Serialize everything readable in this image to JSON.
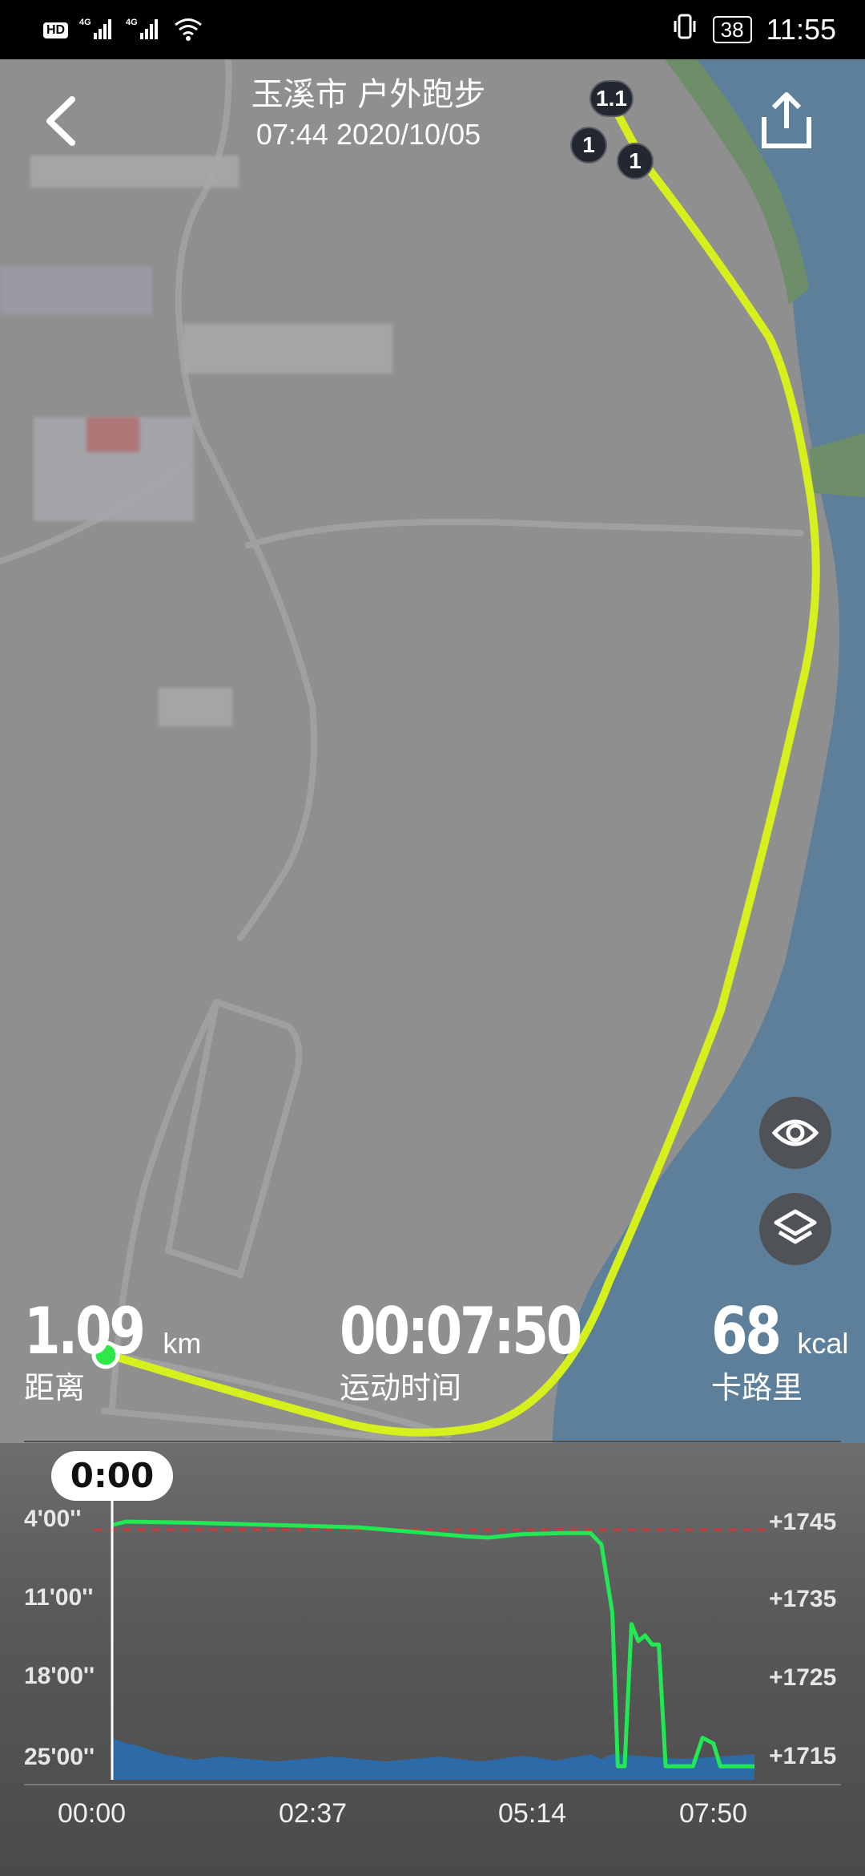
{
  "status_bar": {
    "network_left": "HD",
    "network_1": "4G",
    "network_2": "4G",
    "battery": "38",
    "time": "11:55"
  },
  "header": {
    "title": "玉溪市 户外跑步",
    "subtitle": "07:44 2020/10/05"
  },
  "map": {
    "km_markers": [
      "1",
      "1.1",
      "1"
    ],
    "route_color": "#d6f01e",
    "start_marker_color": "#2ee84a"
  },
  "stats": {
    "distance": {
      "value": "1.09",
      "unit": "km",
      "label": "距离"
    },
    "duration": {
      "value": "00:07:50",
      "label": "运动时间"
    },
    "calories": {
      "value": "68",
      "unit": "kcal",
      "label": "卡路里"
    }
  },
  "chart": {
    "current_time": "0:00",
    "pace_ticks": [
      "4'00''",
      "11'00''",
      "18'00''",
      "25'00''"
    ],
    "altitude_ticks": [
      "+1745",
      "+1735",
      "+1725",
      "+1715"
    ],
    "x_ticks": [
      "00:00",
      "02:37",
      "05:14",
      "07:50"
    ]
  },
  "chart_data": {
    "type": "line",
    "x_unit": "elapsed time (mm:ss)",
    "pace_axis": {
      "label_ticks": [
        "4'00''",
        "11'00''",
        "18'00''",
        "25'00''"
      ],
      "inverted": true
    },
    "altitude_axis": {
      "label_ticks": [
        1745,
        1735,
        1725,
        1715
      ]
    },
    "series": [
      {
        "kind": "line",
        "color": "#22e854",
        "points_time_s": [
          0,
          10,
          60,
          120,
          180,
          230,
          260,
          275,
          300,
          330,
          350,
          358,
          366,
          370,
          375,
          380,
          385,
          390,
          395,
          400,
          405,
          420,
          425,
          432,
          440,
          445,
          450,
          470
        ],
        "pace_min": [
          4.3,
          4.0,
          4.1,
          4.3,
          4.5,
          5.0,
          5.3,
          5.4,
          5.1,
          5.0,
          5.0,
          6.0,
          12.0,
          25.5,
          25.5,
          13.0,
          14.5,
          14.0,
          14.8,
          14.8,
          25.5,
          25.5,
          25.5,
          23.0,
          23.5,
          25.5,
          25.5,
          25.5
        ]
      },
      {
        "kind": "area",
        "color": "#2c6aa8",
        "points_time_s": [
          0,
          20,
          40,
          80,
          160,
          240,
          300,
          350,
          366,
          470
        ],
        "altitude": [
          1717.8,
          1716.8,
          1715.7,
          1715.5,
          1715.5,
          1715.5,
          1715.6,
          1715.8,
          1715.8,
          1715.8
        ]
      },
      {
        "kind": "reference",
        "style": "dashed",
        "color": "#cc3b3b",
        "pace_min": 4.7
      }
    ],
    "xlim_s": [
      0,
      470
    ]
  }
}
